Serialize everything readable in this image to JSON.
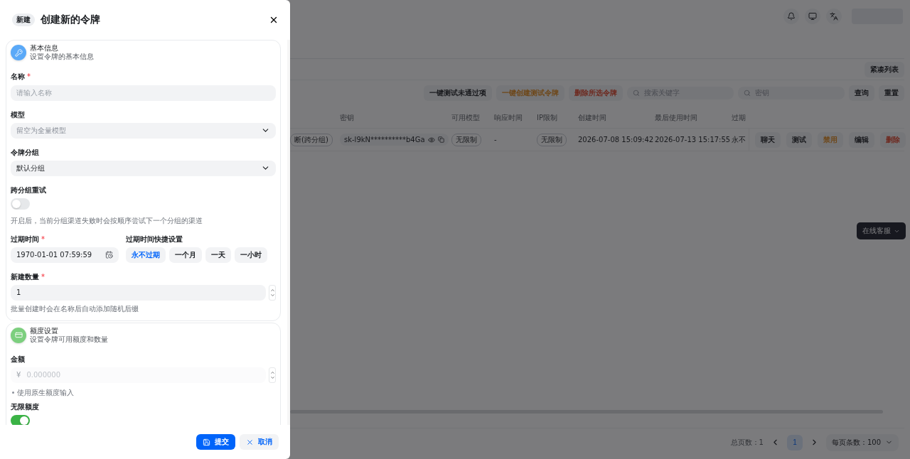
{
  "drawer": {
    "badge": "新建",
    "title": "创建新的令牌",
    "sections": [
      {
        "kind": "basic",
        "title": "基本信息",
        "subtitle": "设置令牌的基本信息",
        "fields": [
          {
            "kind": "text",
            "label": "名称",
            "required_mark": "*",
            "placeholder": "请输入名称"
          },
          {
            "kind": "select",
            "label": "模型",
            "placeholder": "留空为全量模型"
          },
          {
            "kind": "select",
            "label": "令牌分组",
            "value": "默认分组"
          },
          {
            "kind": "switch",
            "label": "跨分组重试",
            "on": false,
            "help": "开启后，当前分组渠道失败时会按顺序尝试下一个分组的渠道"
          },
          {
            "kind": "expiry",
            "label": "过期时间",
            "required_mark": "*",
            "value": "1970-01-01 07:59:59",
            "quick_label": "过期时间快捷设置",
            "quick": [
              {
                "label": "永不过期",
                "selected": true
              },
              {
                "label": "一个月",
                "selected": false
              },
              {
                "label": "一天",
                "selected": false
              },
              {
                "label": "一小时",
                "selected": false
              }
            ]
          },
          {
            "kind": "number",
            "label": "新建数量",
            "required_mark": "*",
            "value": "1",
            "disabled": false,
            "help": "批量创建时会在名称后自动添加随机后缀"
          }
        ]
      },
      {
        "kind": "quota",
        "title": "额度设置",
        "subtitle": "设置令牌可用额度和数量",
        "fields": [
          {
            "kind": "number",
            "label": "金额",
            "prefix": "¥",
            "placeholder": "0.000000",
            "disabled": true
          },
          {
            "kind": "note",
            "text": "使用原生额度输入"
          },
          {
            "kind": "switch",
            "label": "无限额度",
            "on": true
          }
        ]
      }
    ],
    "buttons": [
      {
        "kind": "submit",
        "label": "提交"
      },
      {
        "kind": "cancel",
        "label": "取消"
      }
    ]
  },
  "page": {
    "compact_button": "紧凑列表",
    "toolbar": {
      "actions": [
        {
          "label": "一键测试未通过项",
          "kind": "default"
        },
        {
          "label": "一键创建测试令牌",
          "kind": "warning"
        },
        {
          "label": "删除所选令牌",
          "kind": "danger"
        }
      ],
      "search_fields": [
        {
          "placeholder": "搜索关键字"
        },
        {
          "placeholder": "密钥"
        }
      ],
      "buttons": [
        "查询",
        "重置"
      ]
    },
    "table": {
      "columns": [
        {
          "label": "密钥",
          "kind": "key"
        },
        {
          "label": "可用模型",
          "kind": "tag"
        },
        {
          "label": "响应时间",
          "kind": "plain"
        },
        {
          "label": "IP限制",
          "kind": "tag"
        },
        {
          "label": "创建时间",
          "kind": "plain"
        },
        {
          "label": "最后使用时间",
          "kind": "plain"
        },
        {
          "label": "过期",
          "kind": "plain"
        }
      ],
      "rows": [
        {
          "group": "断(跨分组)",
          "cells": [
            "sk-l9kN**********b4Ga",
            "无限制",
            "-",
            "无限制",
            "2026-07-08 15:09:42",
            "2026-07-13 15:17:55",
            "永不"
          ],
          "actions": [
            {
              "label": "聊天",
              "kind": "default"
            },
            {
              "label": "测试",
              "kind": "default"
            },
            {
              "label": "禁用",
              "kind": "warning"
            },
            {
              "label": "编辑",
              "kind": "default"
            },
            {
              "label": "删除",
              "kind": "danger"
            }
          ]
        }
      ]
    },
    "pagination": {
      "total": "总页数：1",
      "pages": [
        {
          "label": "1",
          "selected": true
        }
      ],
      "page_size": "每页条数：100"
    },
    "support_button": "在线客服"
  }
}
